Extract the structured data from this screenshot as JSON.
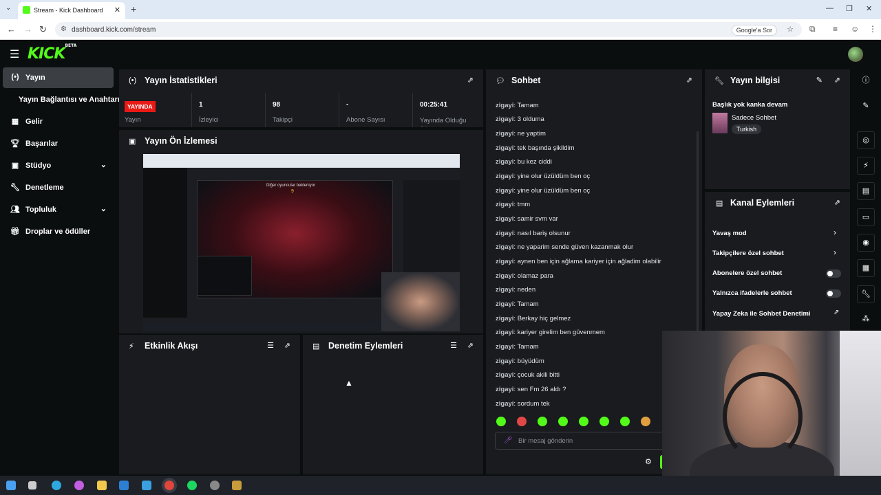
{
  "browser": {
    "tab_title": "Stream - Kick Dashboard",
    "url": "dashboard.kick.com/stream",
    "google_chip": "Google'a Sor"
  },
  "app": {
    "logo": "KICK",
    "logo_badge": "BETA",
    "accent_color": "#53fc18"
  },
  "sidebar": {
    "items": [
      {
        "label": "Yayın",
        "icon": "broadcast-icon",
        "active": true
      },
      {
        "label": "Yayın Bağlantısı ve Anahtarı",
        "icon": "",
        "active": false
      },
      {
        "label": "Gelir",
        "icon": "revenue-icon",
        "active": false
      },
      {
        "label": "Başarılar",
        "icon": "trophy-icon",
        "active": false
      },
      {
        "label": "Stüdyo",
        "icon": "studio-icon",
        "active": false,
        "expandable": true
      },
      {
        "label": "Denetleme",
        "icon": "wrench-icon",
        "active": false
      },
      {
        "label": "Topluluk",
        "icon": "community-icon",
        "active": false,
        "expandable": true
      },
      {
        "label": "Droplar ve ödüller",
        "icon": "gift-icon",
        "active": false
      }
    ]
  },
  "stats_panel": {
    "title": "Yayın İstatistikleri",
    "live_badge": "YAYINDA",
    "stats": [
      {
        "value": "",
        "label": "Yayın"
      },
      {
        "value": "1",
        "label": "İzleyici"
      },
      {
        "value": "98",
        "label": "Takipçi"
      },
      {
        "value": "-",
        "label": "Abone Sayısı"
      },
      {
        "value": "00:25:41",
        "label": "Yayında Olduğu Süre"
      }
    ]
  },
  "preview_panel": {
    "title": "Yayın Ön İzlemesi",
    "preview_text": "Diğer oyuncular bekleniyor",
    "preview_count": "9"
  },
  "activity_panel": {
    "title": "Etkinlik Akışı"
  },
  "moderation_panel": {
    "title": "Denetim Eylemleri"
  },
  "chat": {
    "title": "Sohbet",
    "username": "zigayi",
    "messages": [
      "Tamam",
      "3 olduma",
      "ne yaptim",
      "tek başında şikildim",
      "bu kez ciddi",
      "yine olur üzüldüm ben oç",
      "yine olur üzüldüm ben oç",
      "tmm",
      "samir svm var",
      "nasıl bariş olsunur",
      "ne yaparim sende güven kazanmak olur",
      "aynen ben için ağlama kariyer için ağladim olabilir",
      "olamaz para",
      "neden",
      "Tamam",
      "Berkay hiç gelmez",
      "kariyer girelim ben güvenmem",
      "Tamam",
      "büyüdüm",
      "çocuk akili bitti",
      "sen Fm 26 aldı ?",
      "sordum tek"
    ],
    "input_placeholder": "Bir mesaj gönderin"
  },
  "stream_info": {
    "title": "Yayın bilgisi",
    "stream_title": "Başlık yok kanka devam",
    "category": "Sadece Sohbet",
    "language": "Turkish"
  },
  "channel_actions": {
    "title": "Kanal Eylemleri",
    "items": [
      {
        "label": "Yavaş mod",
        "control": "arrow"
      },
      {
        "label": "Takipçilere özel sohbet",
        "control": "arrow"
      },
      {
        "label": "Abonelere özel sohbet",
        "control": "toggle",
        "on": false
      },
      {
        "label": "Yalnızca ifadelerle sohbet",
        "control": "toggle",
        "on": false
      },
      {
        "label": "Yapay Zeka ile Sohbet Denetimi",
        "control": "external"
      }
    ]
  }
}
